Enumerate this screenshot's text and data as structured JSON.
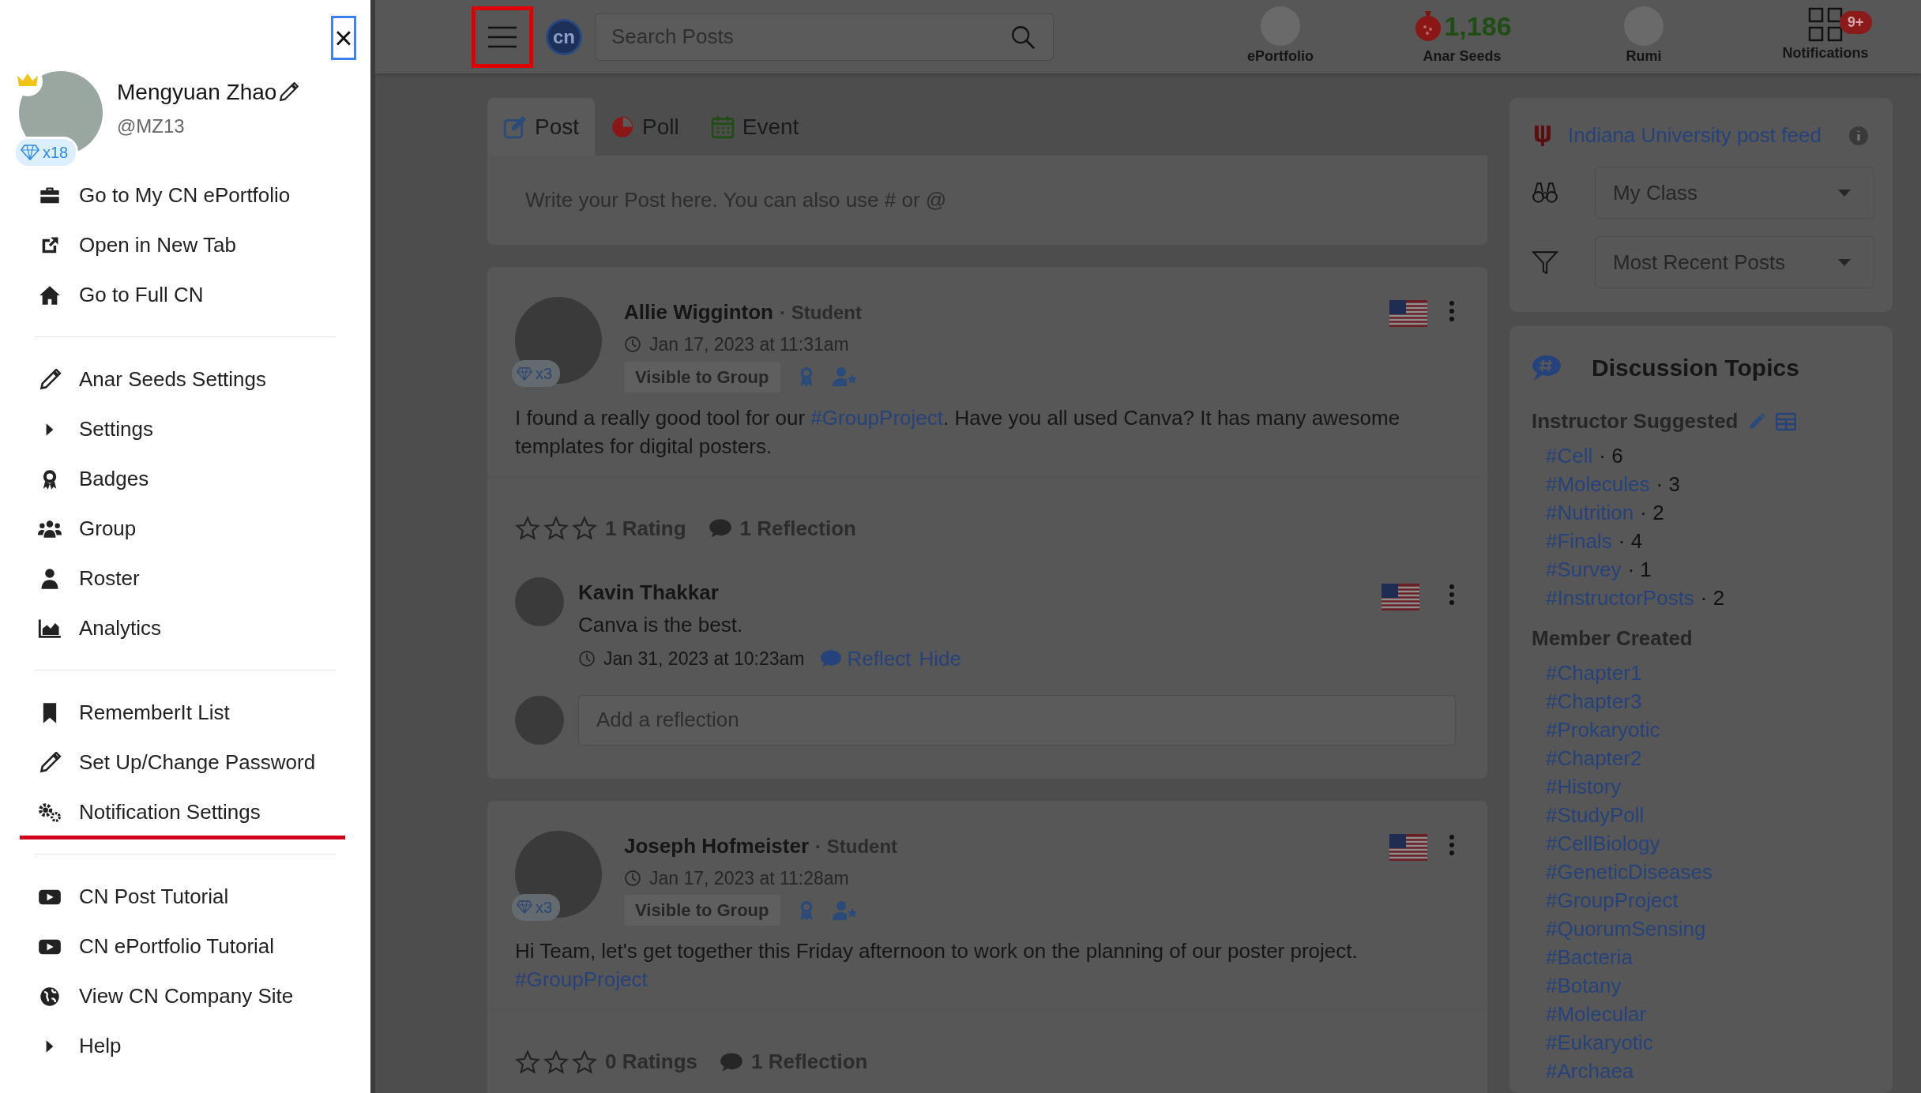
{
  "drawer": {
    "close_focused": true,
    "close_label": "×",
    "user": {
      "name": "Mengyuan Zhao",
      "handle": "@MZ13",
      "gems": "x18"
    },
    "groups": [
      [
        {
          "kind": "link",
          "label": "Go to My CN ePortfolio",
          "highlighted": false
        },
        {
          "kind": "link",
          "label": "Open in New Tab",
          "highlighted": false
        },
        {
          "kind": "link",
          "label": "Go to Full CN",
          "highlighted": false
        }
      ],
      [
        {
          "kind": "link",
          "label": "Anar Seeds Settings",
          "highlighted": false
        },
        {
          "kind": "submenu",
          "label": "Settings",
          "expanded": false,
          "highlighted": false
        },
        {
          "kind": "link",
          "label": "Badges",
          "highlighted": false
        },
        {
          "kind": "link",
          "label": "Group",
          "highlighted": false
        },
        {
          "kind": "link",
          "label": "Roster",
          "highlighted": false
        },
        {
          "kind": "link",
          "label": "Analytics",
          "highlighted": false
        }
      ],
      [
        {
          "kind": "link",
          "label": "RememberIt List",
          "highlighted": false
        },
        {
          "kind": "link",
          "label": "Set Up/Change Password",
          "highlighted": false
        },
        {
          "kind": "link",
          "label": "Notification Settings",
          "highlighted": true
        }
      ],
      [
        {
          "kind": "link",
          "label": "CN Post Tutorial",
          "highlighted": false
        },
        {
          "kind": "link",
          "label": "CN ePortfolio Tutorial",
          "highlighted": false
        },
        {
          "kind": "link",
          "label": "View CN Company Site",
          "highlighted": false
        },
        {
          "kind": "submenu",
          "label": "Help",
          "expanded": false,
          "highlighted": false
        }
      ]
    ]
  },
  "topbar": {
    "menu_highlighted": true,
    "logo": "cn",
    "search": {
      "placeholder": "Search Posts"
    },
    "items": [
      {
        "kind": "avatar",
        "label": "ePortfolio"
      },
      {
        "kind": "seeds",
        "label": "Anar Seeds",
        "count": "1,186"
      },
      {
        "kind": "avatar",
        "label": "Rumi"
      },
      {
        "kind": "grid",
        "label": "Notifications",
        "badge": "9+"
      }
    ]
  },
  "composer": {
    "tabs": [
      {
        "label": "Post",
        "selected": true
      },
      {
        "label": "Poll",
        "selected": false
      },
      {
        "label": "Event",
        "selected": false
      }
    ],
    "placeholder": "Write your Post here. You can also use # or @"
  },
  "posts": [
    {
      "author": "Allie Wigginton",
      "role": "· Student",
      "gems": "x3",
      "time": "Jan 17, 2023 at 11:31am",
      "visibility": "Visible to Group",
      "body": [
        {
          "kind": "text",
          "text": "I found a really good tool for our "
        },
        {
          "kind": "hashtag",
          "text": "#GroupProject"
        },
        {
          "kind": "text",
          "text": ". Have you all used Canva? It has many awesome templates for digital posters."
        }
      ],
      "stars": 0,
      "ratings": "1 Rating",
      "reflections": "1 Reflection",
      "comments": [
        {
          "author": "Kavin Thakkar",
          "text": "Canva is the best.",
          "time": "Jan 31, 2023 at 10:23am",
          "reflect": "Reflect",
          "hide": "Hide"
        }
      ],
      "reflection_placeholder": "Add a reflection"
    },
    {
      "author": "Joseph Hofmeister",
      "role": "· Student",
      "gems": "x3",
      "time": "Jan 17, 2023 at 11:28am",
      "visibility": "Visible to Group",
      "body": [
        {
          "kind": "text",
          "text": "Hi Team, let's get together this Friday afternoon to work on the planning of our poster project. "
        },
        {
          "kind": "hashtag",
          "text": "#GroupProject"
        }
      ],
      "stars": 0,
      "ratings": "0 Ratings",
      "reflections": "1 Reflection"
    }
  ],
  "feed": {
    "title": "Indiana University post feed",
    "filters": [
      {
        "value": "My Class"
      },
      {
        "value": "Most Recent Posts"
      }
    ]
  },
  "topics": {
    "title": "Discussion Topics",
    "sections": [
      {
        "title": "Instructor Suggested",
        "editable": true,
        "items": [
          {
            "tag": "#Cell",
            "count": "· 6"
          },
          {
            "tag": "#Molecules",
            "count": "· 3"
          },
          {
            "tag": "#Nutrition",
            "count": "· 2"
          },
          {
            "tag": "#Finals",
            "count": "· 4"
          },
          {
            "tag": "#Survey",
            "count": "· 1"
          },
          {
            "tag": "#InstructorPosts",
            "count": "· 2"
          }
        ]
      },
      {
        "title": "Member Created",
        "editable": false,
        "items": [
          {
            "tag": "#Chapter1"
          },
          {
            "tag": "#Chapter3"
          },
          {
            "tag": "#Prokaryotic"
          },
          {
            "tag": "#Chapter2"
          },
          {
            "tag": "#History"
          },
          {
            "tag": "#StudyPoll"
          },
          {
            "tag": "#CellBiology"
          },
          {
            "tag": "#GeneticDiseases"
          },
          {
            "tag": "#GroupProject"
          },
          {
            "tag": "#QuorumSensing"
          },
          {
            "tag": "#Bacteria"
          },
          {
            "tag": "#Botany"
          },
          {
            "tag": "#Molecular"
          },
          {
            "tag": "#Eukaryotic"
          },
          {
            "tag": "#Archaea"
          }
        ]
      }
    ]
  }
}
